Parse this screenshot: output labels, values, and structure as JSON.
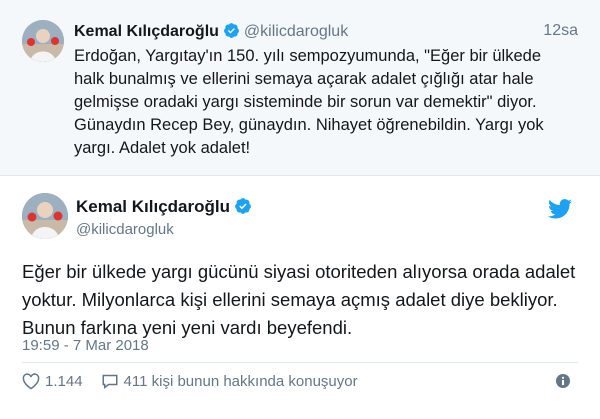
{
  "quoted_tweet": {
    "author_name": "Kemal Kılıçdaroğlu",
    "author_handle": "@kilicdarogluk",
    "time": "12sa",
    "text": "Erdoğan, Yargıtay'ın 150. yılı sempozyumunda, \"Eğer bir ülkede halk bunalmış ve ellerini semaya açarak adalet çığlığı atar hale gelmişse oradaki yargı sisteminde bir sorun var demektir\" diyor. Günaydın Recep Bey, günaydın. Nihayet öğrenebildin. Yargı yok yargı. Adalet yok adalet!"
  },
  "main_tweet": {
    "author_name": "Kemal Kılıçdaroğlu",
    "author_handle": "@kilicdarogluk",
    "text": "Eğer bir ülkede yargı gücünü siyasi otoriteden alıyorsa orada adalet yoktur. Milyonlarca kişi ellerini semaya açmış adalet diye bekliyor. Bunun farkına yeni yeni vardı beyefendi.",
    "timestamp": "19:59 - 7 Mar 2018",
    "likes": "1.144",
    "talking_about": "411 kişi bunun hakkında konuşuyor"
  },
  "icons": {
    "verified": "verified-badge-icon",
    "brand": "twitter-bird-icon",
    "like": "heart-icon",
    "reply": "speech-bubble-icon",
    "info": "info-icon"
  },
  "colors": {
    "verified_blue": "#1da1f2",
    "twitter_blue": "#1da1f2",
    "muted_text": "#657786",
    "quoted_background": "#f5f8fa"
  }
}
